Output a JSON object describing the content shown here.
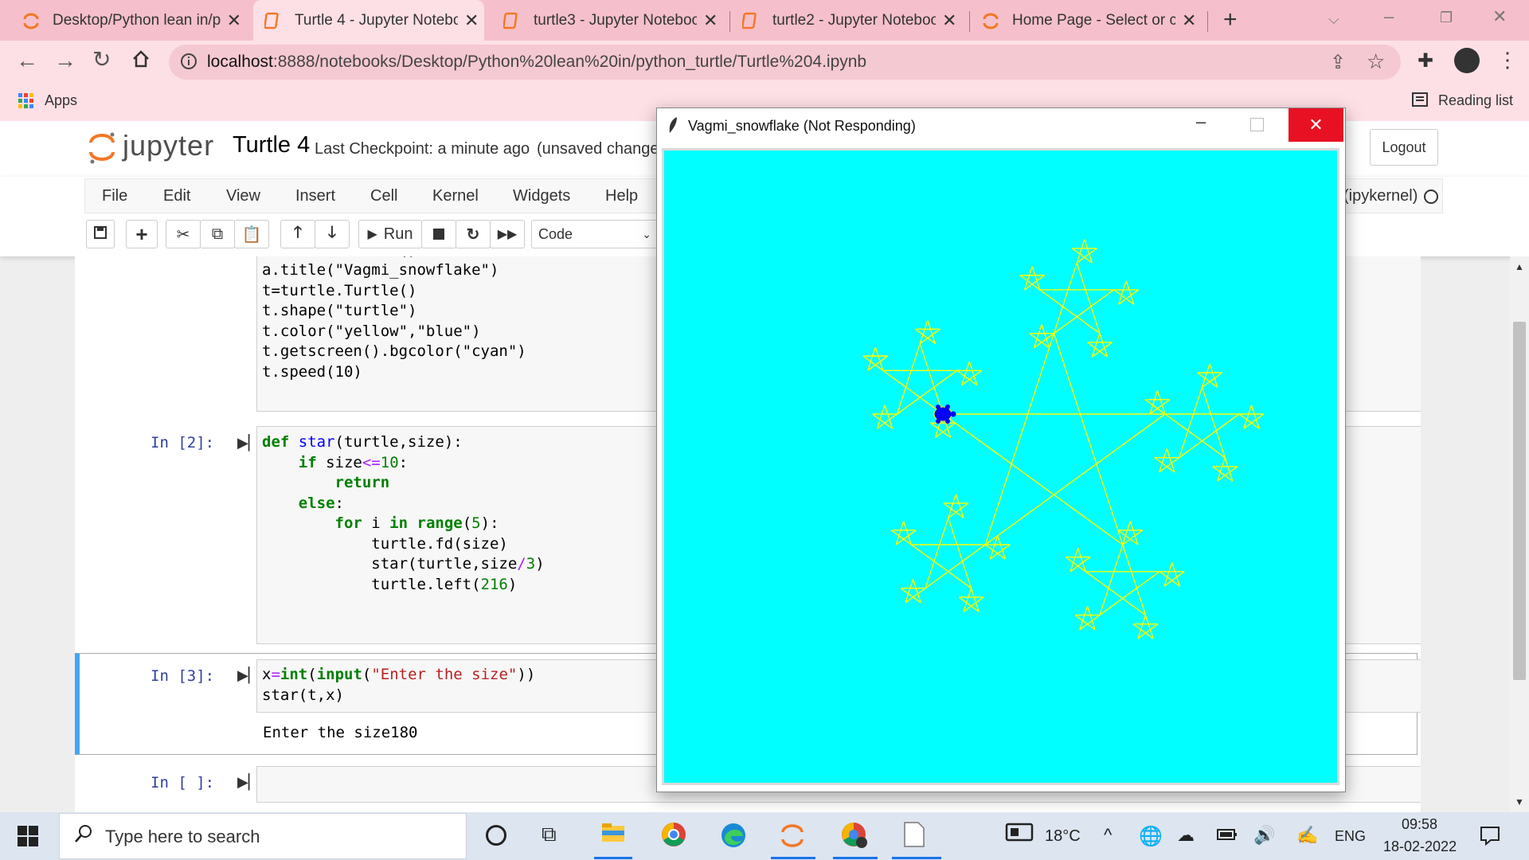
{
  "browser": {
    "tabs": [
      {
        "title": "Desktop/Python lean in/p",
        "active": false
      },
      {
        "title": "Turtle 4 - Jupyter Notebo",
        "active": true
      },
      {
        "title": "turtle3 - Jupyter Noteboo",
        "active": false
      },
      {
        "title": "turtle2 - Jupyter Noteboo",
        "active": false
      },
      {
        "title": "Home Page - Select or cre",
        "active": false
      }
    ],
    "url_host": "localhost",
    "url_path": ":8888/notebooks/Desktop/Python%20lean%20in/python_turtle/Turtle%204.ipynb",
    "bookmarks_apps": "Apps",
    "reading_list": "Reading list"
  },
  "jupyter": {
    "logo": "jupyter",
    "notebook_name": "Turtle 4",
    "checkpoint": "Last Checkpoint: a minute ago",
    "unsaved": "(unsaved changes)",
    "logout": "Logout",
    "kernel": "(ipykernel)",
    "menu": [
      "File",
      "Edit",
      "View",
      "Insert",
      "Cell",
      "Kernel",
      "Widgets",
      "Help"
    ],
    "run_label": "Run",
    "cell_type": "Code"
  },
  "cells": {
    "c1_code": "import turtle\na=turtle.Screen()\na.title(\"Vagmi_snowflake\")\nt=turtle.Turtle()\nt.shape(\"turtle\")\nt.color(\"yellow\",\"blue\")\nt.getscreen().bgcolor(\"cyan\")\nt.speed(10)",
    "c2_prompt": "In [2]:",
    "c3_prompt": "In [3]:",
    "c3_output": "Enter the size180",
    "c4_prompt": "In [ ]:"
  },
  "turtle_window": {
    "title": "Vagmi_snowflake (Not Responding)",
    "bgcolor": "#00ffff",
    "pen_color": "#ffff00",
    "fill_color": "#0000ff",
    "recursion_angle": 216,
    "size": 180,
    "divisor": 3,
    "min_size": 10
  },
  "taskbar": {
    "search_placeholder": "Type here to search",
    "weather": "18°C",
    "language": "ENG",
    "time": "09:58",
    "date": "18-02-2022"
  }
}
